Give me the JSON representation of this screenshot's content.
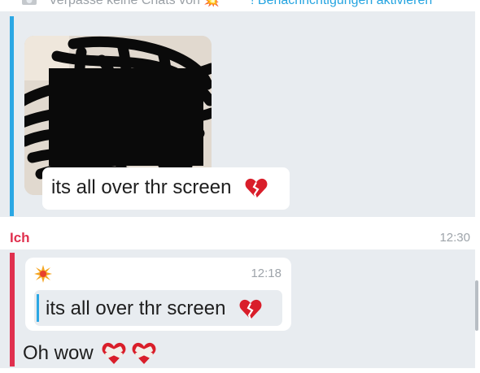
{
  "banner": {
    "text_lead": "Verpasse keine Chats von",
    "burst_glyph": "💥",
    "link_text": "! Benachrichtigungen aktivieren",
    "icon": "camera-icon"
  },
  "message_incoming": {
    "media": "redacted-image",
    "caption": "its all over thr screen",
    "emoji": "broken-heart-icon",
    "accent": "#2ba7e4"
  },
  "message_own": {
    "sender": "Ich",
    "time": "12:30",
    "accent": "#e0304e",
    "quote": {
      "icon": "burst-icon",
      "time": "12:18",
      "text": "its all over thr screen",
      "emoji": "broken-heart-icon"
    },
    "reply": "Oh wow",
    "reply_emojis": [
      "bandaged-heart-icon",
      "bandaged-heart-icon"
    ]
  }
}
